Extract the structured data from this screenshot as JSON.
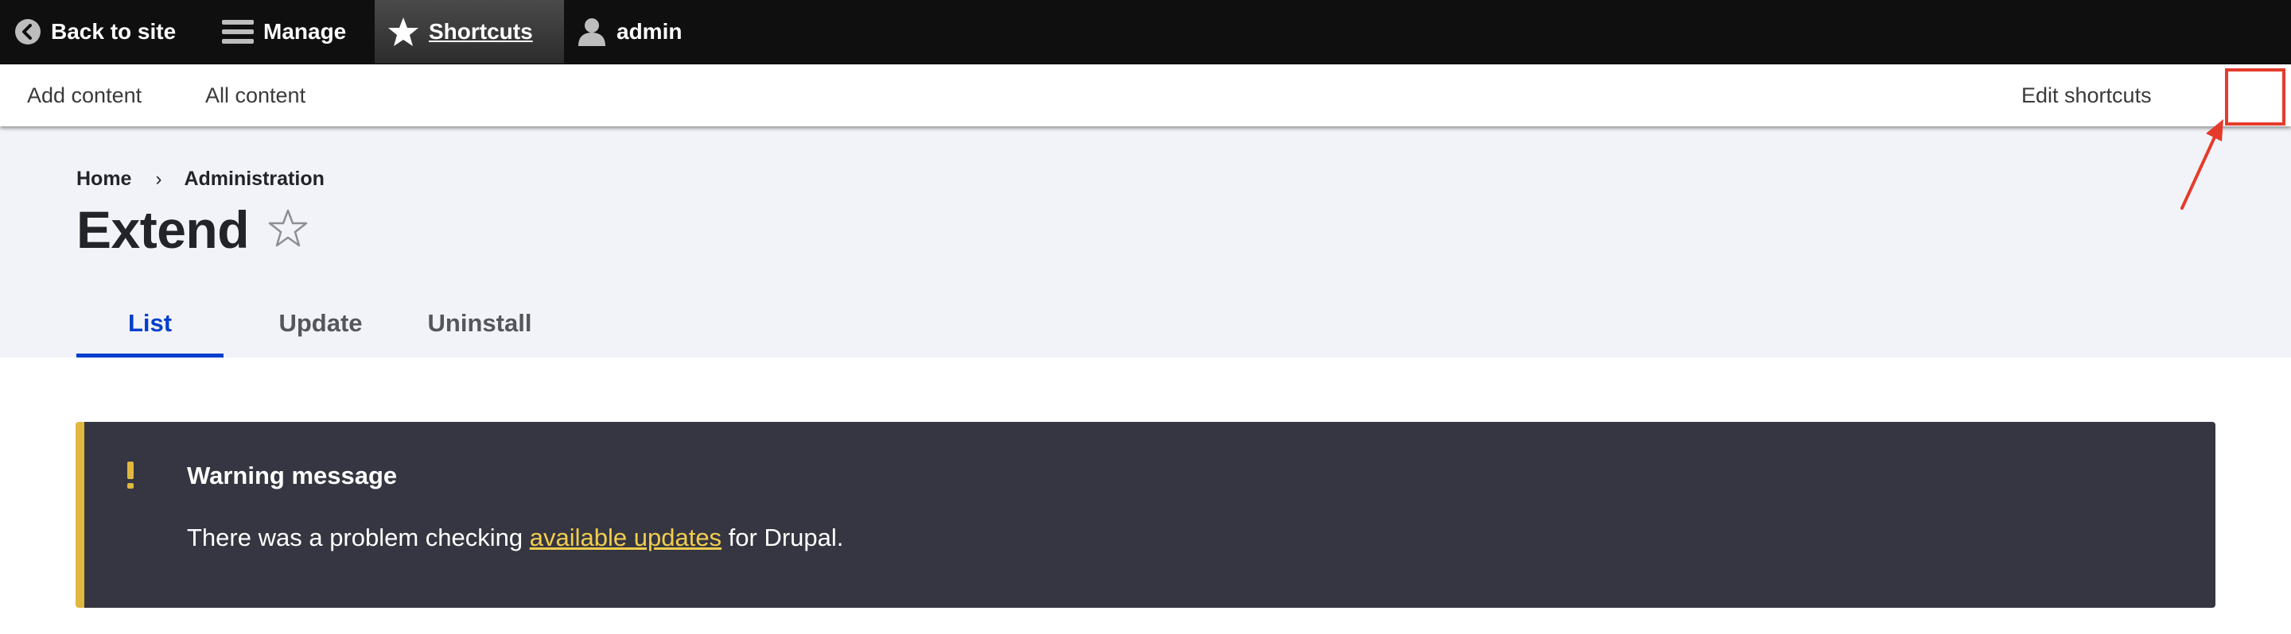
{
  "toolbar": {
    "back_label": "Back to site",
    "manage_label": "Manage",
    "shortcuts_label": "Shortcuts",
    "user_label": "admin",
    "icons": {
      "back": "chevron-left-circle-icon",
      "manage": "hamburger-icon",
      "shortcuts": "star-icon",
      "user": "person-icon"
    }
  },
  "shortcuts_tray": {
    "add_content": "Add content",
    "all_content": "All content",
    "edit_shortcuts": "Edit shortcuts"
  },
  "breadcrumb": {
    "items": [
      "Home",
      "Administration"
    ],
    "separator": "›"
  },
  "page": {
    "title": "Extend",
    "star_icon": "star-outline-icon"
  },
  "tabs": [
    {
      "label": "List",
      "active": true
    },
    {
      "label": "Update",
      "active": false
    },
    {
      "label": "Uninstall",
      "active": false
    }
  ],
  "warning": {
    "title": "Warning message",
    "text_before": "There was a problem checking ",
    "link_text": "available updates",
    "text_after": " for Drupal.",
    "icon": "exclamation-icon"
  },
  "colors": {
    "toolbar_bg": "#0f0f0f",
    "header_bg": "#f2f3f8",
    "active_tab": "#003ecc",
    "warning_bg": "#353641",
    "warning_accent": "#e0b83f",
    "warning_link": "#f2cd4f",
    "annotation": "#e53b2c"
  }
}
